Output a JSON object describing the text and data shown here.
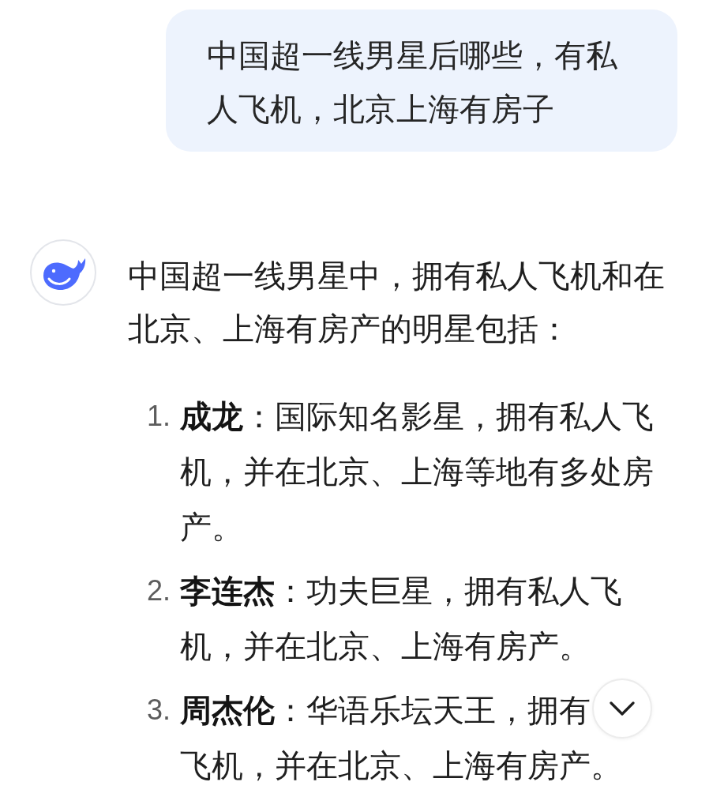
{
  "user_message": {
    "text": "中国超一线男星后哪些，有私人飞机，北京上海有房子"
  },
  "assistant_message": {
    "intro": "中国超一线男星中，拥有私人飞机和在北京、上海有房产的明星包括：",
    "items": [
      {
        "number": "1.",
        "text": "**成龙**：国际知名影星，拥有私人飞机，并在北京、上海等地有多处房产。"
      },
      {
        "number": "2.",
        "text": "**李连杰**：功夫巨星，拥有私人飞机，并在北京、上海有房产。"
      },
      {
        "number": "3.",
        "text": "**周杰伦**：华语乐坛天王，拥有",
        "continued": "飞机，并在北京、上海有房产。"
      }
    ]
  }
}
